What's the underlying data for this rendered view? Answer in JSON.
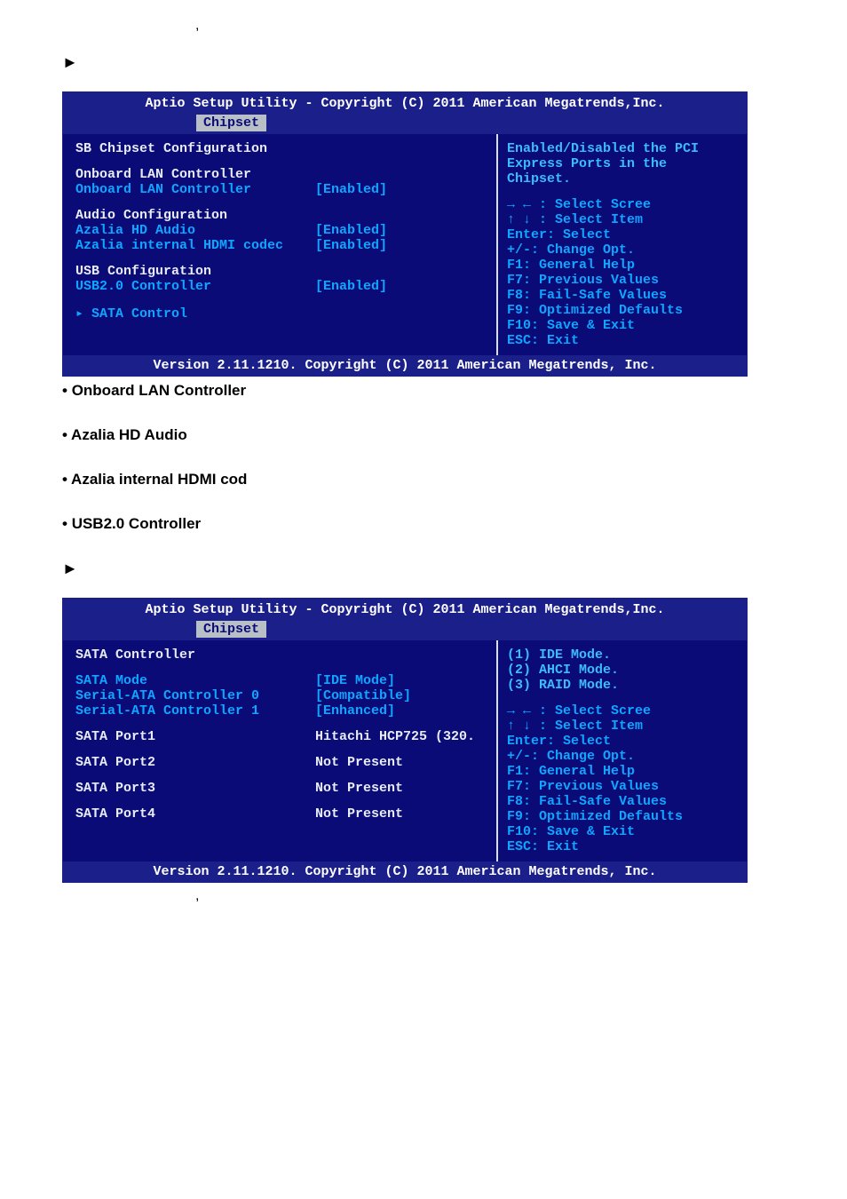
{
  "commas": {
    "top": ",",
    "bottom": ","
  },
  "arrows": {
    "a1": "►",
    "a2": "►"
  },
  "bios1": {
    "title": "Aptio Setup Utility - Copyright (C) 2011 American Megatrends,Inc.",
    "tab": "Chipset",
    "left": {
      "heading": "SB Chipset Configuration",
      "section1_heading": "Onboard LAN Controller",
      "items1": [
        {
          "label": "Onboard LAN Controller",
          "value": "[Enabled]"
        }
      ],
      "section2_heading": "Audio Configuration",
      "items2": [
        {
          "label": "Azalia HD Audio",
          "value": "[Enabled]"
        },
        {
          "label": "Azalia internal HDMI codec",
          "value": "[Enabled]"
        }
      ],
      "section3_heading": "USB Configuration",
      "items3": [
        {
          "label": "USB2.0 Controller",
          "value": "[Enabled]"
        }
      ],
      "submenu": "▸ SATA Control"
    },
    "right": {
      "desc": "Enabled/Disabled the PCI Express Ports in the Chipset.",
      "help": [
        "→ ← :  Select Scree",
        "↑ ↓ :  Select Item",
        "Enter: Select",
        "+/-:   Change Opt.",
        "F1: General Help",
        "F7: Previous Values",
        "F8: Fail-Safe Values",
        "F9: Optimized Defaults",
        "F10: Save & Exit",
        "ESC: Exit"
      ]
    },
    "footer": "Version 2.11.1210. Copyright (C) 2011 American Megatrends, Inc."
  },
  "bullets": [
    "Onboard LAN Controller",
    "Azalia HD Audio",
    "Azalia internal HDMI cod",
    "USB2.0 Controller"
  ],
  "bios2": {
    "title": "Aptio Setup Utility - Copyright (C) 2011 American Megatrends,Inc.",
    "tab": "Chipset",
    "left": {
      "heading": "SATA Controller",
      "items": [
        {
          "label": "SATA Mode",
          "value": "[IDE Mode]",
          "cyanLabel": true
        },
        {
          "label": "Serial-ATA Controller 0",
          "value": "[Compatible]",
          "cyanLabel": true
        },
        {
          "label": "Serial-ATA Controller 1",
          "value": "[Enhanced]",
          "cyanLabel": true
        }
      ],
      "ports": [
        {
          "label": "SATA Port1",
          "value": "Hitachi HCP725 (320."
        },
        {
          "label": "SATA Port2",
          "value": "Not Present"
        },
        {
          "label": "SATA Port3",
          "value": "Not Present"
        },
        {
          "label": "SATA Port4",
          "value": "Not Present"
        }
      ]
    },
    "right": {
      "modes": [
        "(1) IDE Mode.",
        "(2) AHCI Mode.",
        "(3) RAID Mode."
      ],
      "help": [
        "→ ← :  Select Scree",
        "↑ ↓ :  Select Item",
        "Enter: Select",
        "+/-:   Change Opt.",
        "F1: General Help",
        "F7: Previous Values",
        "F8: Fail-Safe Values",
        "F9: Optimized Defaults",
        "F10: Save & Exit",
        "ESC: Exit"
      ]
    },
    "footer": "Version 2.11.1210. Copyright (C) 2011 American Megatrends, Inc."
  }
}
